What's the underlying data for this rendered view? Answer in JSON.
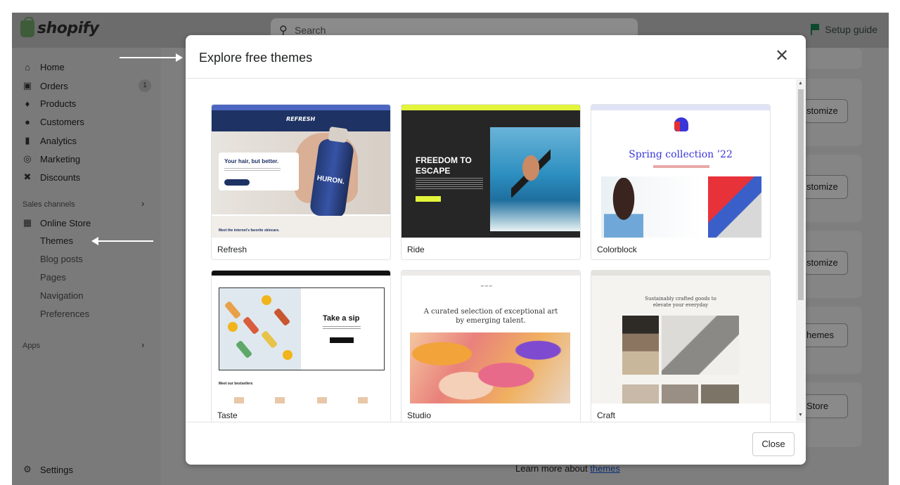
{
  "app": {
    "brand": "shopify",
    "search_placeholder": "Search",
    "setup_guide": "Setup guide"
  },
  "sidebar": {
    "items": [
      {
        "label": "Home",
        "icon": "home-icon"
      },
      {
        "label": "Orders",
        "icon": "orders-icon",
        "badge": "1"
      },
      {
        "label": "Products",
        "icon": "tag-icon"
      },
      {
        "label": "Customers",
        "icon": "person-icon"
      },
      {
        "label": "Analytics",
        "icon": "bar-chart-icon"
      },
      {
        "label": "Marketing",
        "icon": "target-icon"
      },
      {
        "label": "Discounts",
        "icon": "discount-icon"
      }
    ],
    "sales_channels_label": "Sales channels",
    "online_store": "Online Store",
    "sub_items": [
      "Themes",
      "Blog posts",
      "Pages",
      "Navigation",
      "Preferences"
    ],
    "apps_label": "Apps",
    "settings": "Settings"
  },
  "background": {
    "buttons": [
      "stomize",
      "stomize",
      "stomize",
      "hemes",
      "Store"
    ],
    "learn_more_prefix": "Learn more about ",
    "learn_more_link": "themes"
  },
  "modal": {
    "title": "Explore free themes",
    "close_button": "Close",
    "themes": [
      {
        "name": "Refresh",
        "preview_heading": "Your hair, but better.",
        "preview_footer": "Meet the internet's favorite skincare.",
        "preview_logo": "REFRESH",
        "preview_product": "HURON."
      },
      {
        "name": "Ride",
        "preview_heading": "FREEDOM TO ESCAPE"
      },
      {
        "name": "Colorblock",
        "preview_heading": "Spring collection ’22"
      },
      {
        "name": "Taste",
        "preview_heading": "Take a sip",
        "preview_footer": "Meet our bestsellers"
      },
      {
        "name": "Studio",
        "preview_heading": "A curated selection of exceptional art by emerging talent."
      },
      {
        "name": "Craft",
        "preview_heading": "Sustainably crafted goods to elevate your everyday"
      }
    ]
  },
  "colors": {
    "overlay": "#7e7e7e",
    "refresh_navy": "#1e3264",
    "ride_accent": "#e2f53b",
    "colorblock_blue": "#3a35d8"
  }
}
